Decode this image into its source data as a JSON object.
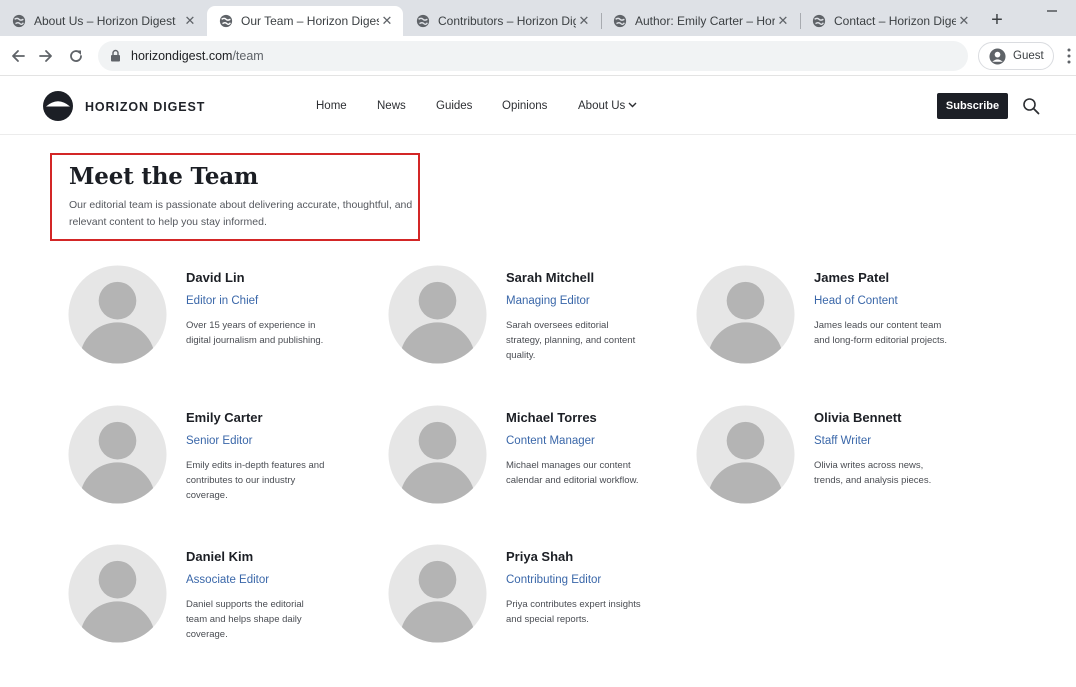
{
  "browser": {
    "tabs": [
      {
        "title": "About Us – Horizon Digest",
        "active": false
      },
      {
        "title": "Our Team – Horizon Digest",
        "active": true
      },
      {
        "title": "Contributors – Horizon Digest",
        "active": false
      },
      {
        "title": "Author: Emily Carter – Horizon",
        "active": false
      },
      {
        "title": "Contact – Horizon Digest",
        "active": false
      }
    ],
    "new_tab_symbol": "+",
    "url_host": "horizondigest.com",
    "url_path": "/team",
    "profile_label": "Guest"
  },
  "site": {
    "logo_text": "HORIZON DIGEST",
    "nav": [
      "Home",
      "News",
      "Guides",
      "Opinions",
      "About Us"
    ],
    "subscribe_label": "Subscribe"
  },
  "hero": {
    "title": "Meet the Team",
    "description": "Our editorial team is passionate about delivering accurate, thoughtful, and relevant content to help you stay informed."
  },
  "team": [
    {
      "name": "David Lin",
      "role": "Editor in Chief",
      "bio": "Over 15 years of experience in digital journalism and publishing."
    },
    {
      "name": "Sarah Mitchell",
      "role": "Managing Editor",
      "bio": "Sarah oversees editorial strategy, planning, and content quality."
    },
    {
      "name": "James Patel",
      "role": "Head of Content",
      "bio": "James leads our content team and long-form editorial projects."
    },
    {
      "name": "Emily Carter",
      "role": "Senior Editor",
      "bio": "Emily edits in-depth features and contributes to our industry coverage."
    },
    {
      "name": "Michael Torres",
      "role": "Content Manager",
      "bio": "Michael manages our content calendar and editorial workflow."
    },
    {
      "name": "Olivia Bennett",
      "role": "Staff Writer",
      "bio": "Olivia writes across news, trends, and analysis pieces."
    },
    {
      "name": "Daniel Kim",
      "role": "Associate Editor",
      "bio": "Daniel supports the editorial team and helps shape daily coverage."
    },
    {
      "name": "Priya Shah",
      "role": "Contributing Editor",
      "bio": "Priya contributes expert insights and special reports."
    }
  ],
  "colors": {
    "tabbar_bg": "#dee1e6",
    "role_link": "#3a67a9",
    "subscribe_bg": "#1c1f26",
    "highlight_border": "#d32626",
    "avatar_bg": "#e6e6e6",
    "avatar_figure": "#b4b4b4"
  },
  "icons": {
    "tab_favicon": "globe-icon",
    "tab_close": "close-icon",
    "back": "arrow-left-icon",
    "forward": "arrow-right-icon",
    "reload": "reload-icon",
    "secure": "lock-icon",
    "profile": "account-circle-icon",
    "menu": "kebab-menu-icon",
    "dropdown": "chevron-down-icon",
    "search": "search-icon",
    "avatar": "person-placeholder-icon"
  }
}
